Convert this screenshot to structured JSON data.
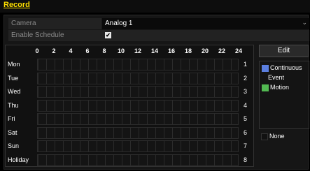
{
  "title": "Record",
  "camera": {
    "label": "Camera",
    "value": "Analog 1"
  },
  "schedule": {
    "label": "Enable Schedule",
    "checked": "✔"
  },
  "grid": {
    "hours": [
      "0",
      "2",
      "4",
      "6",
      "8",
      "10",
      "12",
      "14",
      "16",
      "18",
      "20",
      "22",
      "24"
    ],
    "days": [
      {
        "name": "Mon",
        "num": "1"
      },
      {
        "name": "Tue",
        "num": "2"
      },
      {
        "name": "Wed",
        "num": "3"
      },
      {
        "name": "Thu",
        "num": "4"
      },
      {
        "name": "Fri",
        "num": "5"
      },
      {
        "name": "Sat",
        "num": "6"
      },
      {
        "name": "Sun",
        "num": "7"
      },
      {
        "name": "Holiday",
        "num": "8"
      }
    ]
  },
  "sidebar": {
    "edit_label": "Edit",
    "continuous_label": "Continuous",
    "event_label": "Event",
    "motion_label": "Motion",
    "none_label": "None"
  },
  "colors": {
    "continuous": "#5b7fe0",
    "motion": "#52b952",
    "title": "#ffe000"
  }
}
